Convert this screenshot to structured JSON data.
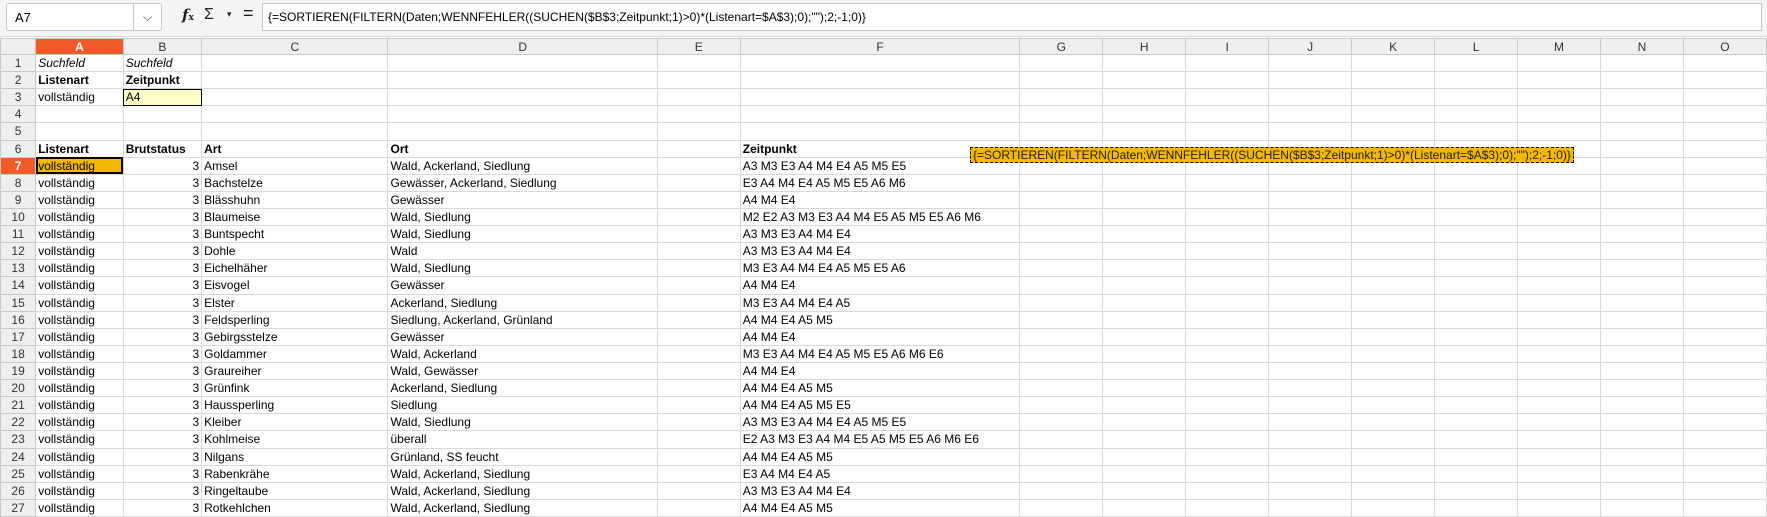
{
  "namebox": {
    "value": "A7",
    "arrow": "⌵"
  },
  "toolbar": {
    "fx_label": "f",
    "fx_sub": "x",
    "sum_label": "Σ",
    "sum_drop": "▾",
    "eq_label": "="
  },
  "formula": "{=SORTIEREN(FILTERN(Daten;WENNFEHLER((SUCHEN($B$3;Zeitpunkt;1)>0)*(Listenart=$A$3);0);\"\");2;-1;0)}",
  "columns": [
    "A",
    "B",
    "C",
    "D",
    "E",
    "F",
    "G",
    "H",
    "I",
    "J",
    "K",
    "L",
    "M",
    "N",
    "O"
  ],
  "row_numbers": [
    "1",
    "2",
    "3",
    "4",
    "5",
    "6",
    "7",
    "8",
    "9",
    "10",
    "11",
    "12",
    "13",
    "14",
    "15",
    "16",
    "17",
    "18",
    "19",
    "20",
    "21",
    "22",
    "23",
    "24",
    "25",
    "26",
    "27"
  ],
  "top": {
    "r1": {
      "a": "Suchfeld",
      "b": "Suchfeld"
    },
    "r2": {
      "a": "Listenart",
      "b": "Zeitpunkt"
    },
    "r3": {
      "a": "vollständig",
      "b": "A4"
    }
  },
  "headers": {
    "listenart": "Listenart",
    "brutstatus": "Brutstatus",
    "art": "Art",
    "ort": "Ort",
    "zeitpunkt": "Zeitpunkt"
  },
  "rows": [
    {
      "listenart": "vollständig",
      "brutstatus": "3",
      "art": "Amsel",
      "ort": "Wald, Ackerland, Siedlung",
      "zeitpunkt": "A3 M3 E3 A4 M4 E4 A5 M5 E5"
    },
    {
      "listenart": "vollständig",
      "brutstatus": "3",
      "art": "Bachstelze",
      "ort": "Gewässer, Ackerland, Siedlung",
      "zeitpunkt": "E3 A4 M4 E4 A5 M5 E5 A6 M6"
    },
    {
      "listenart": "vollständig",
      "brutstatus": "3",
      "art": "Blässhuhn",
      "ort": "Gewässer",
      "zeitpunkt": "A4 M4 E4"
    },
    {
      "listenart": "vollständig",
      "brutstatus": "3",
      "art": "Blaumeise",
      "ort": "Wald, Siedlung",
      "zeitpunkt": "M2 E2 A3 M3 E3 A4 M4 E5 A5 M5 E5 A6 M6"
    },
    {
      "listenart": "vollständig",
      "brutstatus": "3",
      "art": "Buntspecht",
      "ort": "Wald, Siedlung",
      "zeitpunkt": "A3 M3 E3 A4 M4 E4"
    },
    {
      "listenart": "vollständig",
      "brutstatus": "3",
      "art": "Dohle",
      "ort": "Wald",
      "zeitpunkt": "A3 M3 E3 A4 M4 E4"
    },
    {
      "listenart": "vollständig",
      "brutstatus": "3",
      "art": "Eichelhäher",
      "ort": "Wald, Siedlung",
      "zeitpunkt": "M3 E3 A4 M4 E4 A5 M5 E5 A6"
    },
    {
      "listenart": "vollständig",
      "brutstatus": "3",
      "art": "Eisvogel",
      "ort": "Gewässer",
      "zeitpunkt": "A4 M4 E4"
    },
    {
      "listenart": "vollständig",
      "brutstatus": "3",
      "art": "Elster",
      "ort": "Ackerland, Siedlung",
      "zeitpunkt": "M3 E3 A4 M4 E4 A5"
    },
    {
      "listenart": "vollständig",
      "brutstatus": "3",
      "art": "Feldsperling",
      "ort": "Siedlung, Ackerland, Grünland",
      "zeitpunkt": "A4 M4 E4 A5 M5"
    },
    {
      "listenart": "vollständig",
      "brutstatus": "3",
      "art": "Gebirgsstelze",
      "ort": "Gewässer",
      "zeitpunkt": "A4 M4 E4"
    },
    {
      "listenart": "vollständig",
      "brutstatus": "3",
      "art": "Goldammer",
      "ort": "Wald, Ackerland",
      "zeitpunkt": "M3 E3 A4 M4 E4 A5 M5 E5 A6 M6 E6"
    },
    {
      "listenart": "vollständig",
      "brutstatus": "3",
      "art": "Graureiher",
      "ort": "Wald, Gewässer",
      "zeitpunkt": "A4 M4 E4"
    },
    {
      "listenart": "vollständig",
      "brutstatus": "3",
      "art": "Grünfink",
      "ort": "Ackerland, Siedlung",
      "zeitpunkt": "A4 M4 E4 A5 M5"
    },
    {
      "listenart": "vollständig",
      "brutstatus": "3",
      "art": "Haussperling",
      "ort": "Siedlung",
      "zeitpunkt": "A4 M4 E4 A5 M5 E5"
    },
    {
      "listenart": "vollständig",
      "brutstatus": "3",
      "art": "Kleiber",
      "ort": "Wald, Siedlung",
      "zeitpunkt": "A3 M3 E3 A4 M4 E4 A5 M5 E5"
    },
    {
      "listenart": "vollständig",
      "brutstatus": "3",
      "art": "Kohlmeise",
      "ort": "überall",
      "zeitpunkt": "E2 A3 M3 E3 A4 M4 E5 A5 M5 E5 A6 M6 E6"
    },
    {
      "listenart": "vollständig",
      "brutstatus": "3",
      "art": "Nilgans",
      "ort": "Grünland, SS feucht",
      "zeitpunkt": "A4 M4 E4 A5 M5"
    },
    {
      "listenart": "vollständig",
      "brutstatus": "3",
      "art": "Rabenkrähe",
      "ort": "Wald, Ackerland, Siedlung",
      "zeitpunkt": "E3 A4 M4 E4 A5"
    },
    {
      "listenart": "vollständig",
      "brutstatus": "3",
      "art": "Ringeltaube",
      "ort": "Wald, Ackerland, Siedlung",
      "zeitpunkt": "A3 M3 E3 A4 M4 E4"
    },
    {
      "listenart": "vollständig",
      "brutstatus": "3",
      "art": "Rotkehlchen",
      "ort": "Wald, Ackerland, Siedlung",
      "zeitpunkt": "A4 M4 E4 A5 M5"
    }
  ],
  "colors": {
    "accent": "#ef5c2a",
    "formula_fill": "#f5b800",
    "input_fill": "#ffffc8"
  }
}
